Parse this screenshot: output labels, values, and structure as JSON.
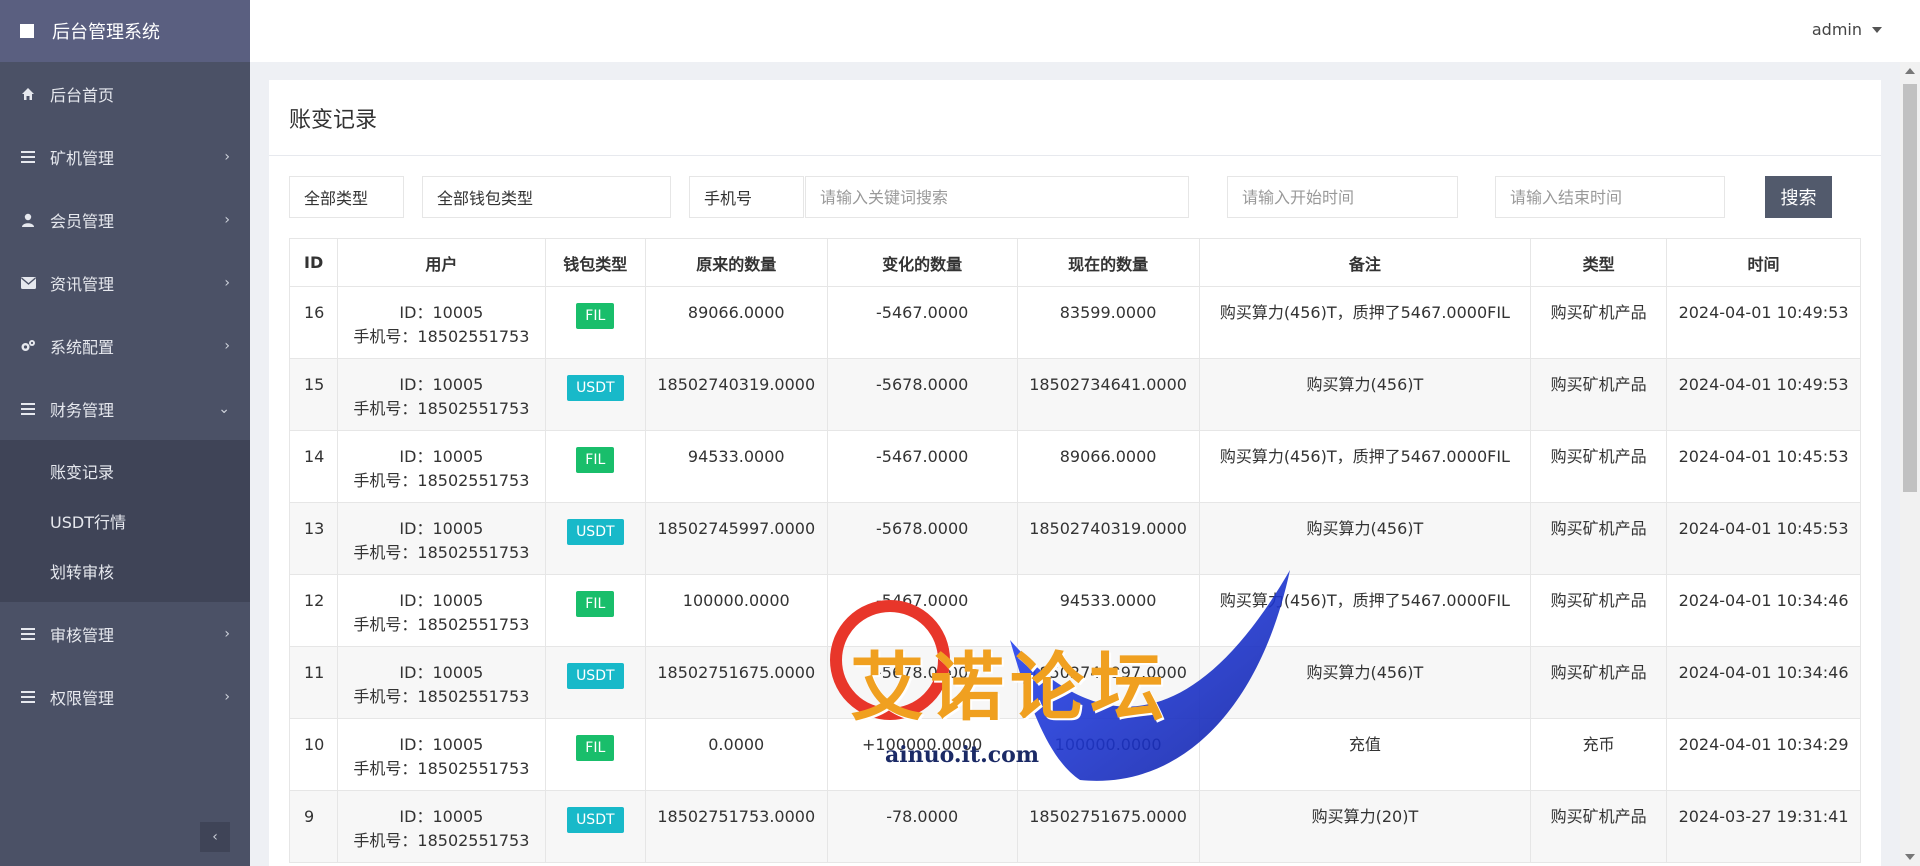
{
  "sidebar": {
    "brand": "后台管理系统",
    "items": [
      {
        "label": "后台首页",
        "icon": "home-icon",
        "chevron": ""
      },
      {
        "label": "矿机管理",
        "icon": "list-icon",
        "chevron": "›"
      },
      {
        "label": "会员管理",
        "icon": "user-icon",
        "chevron": "›"
      },
      {
        "label": "资讯管理",
        "icon": "envelope-icon",
        "chevron": "›"
      },
      {
        "label": "系统配置",
        "icon": "cogs-icon",
        "chevron": "›"
      },
      {
        "label": "财务管理",
        "icon": "list-icon",
        "chevron": "⌄"
      }
    ],
    "subitems": [
      "账变记录",
      "USDT行情",
      "划转审核"
    ],
    "items_after": [
      {
        "label": "审核管理",
        "icon": "list-icon",
        "chevron": "›"
      },
      {
        "label": "权限管理",
        "icon": "list-icon",
        "chevron": "›"
      }
    ],
    "collapse_glyph": "‹"
  },
  "topbar": {
    "user": "admin"
  },
  "panel": {
    "title": "账变记录"
  },
  "filters": {
    "type_select": "全部类型",
    "wallet_select": "全部钱包类型",
    "field_select": "手机号",
    "keyword_placeholder": "请输入关键词搜索",
    "start_placeholder": "请输入开始时间",
    "end_placeholder": "请输入结束时间",
    "search_button": "搜索"
  },
  "table": {
    "headers": [
      "ID",
      "用户",
      "钱包类型",
      "原来的数量",
      "变化的数量",
      "现在的数量",
      "备注",
      "类型",
      "时间"
    ],
    "rows": [
      {
        "id": "16",
        "user_id": "ID：10005",
        "phone": "手机号：18502551753",
        "wallet": "FIL",
        "before": "89066.0000",
        "change": "-5467.0000",
        "after": "83599.0000",
        "remark": "购买算力(456)T，质押了5467.0000FIL",
        "type": "购买矿机产品",
        "time": "2024-04-01 10:49:53"
      },
      {
        "id": "15",
        "user_id": "ID：10005",
        "phone": "手机号：18502551753",
        "wallet": "USDT",
        "before": "18502740319.0000",
        "change": "-5678.0000",
        "after": "18502734641.0000",
        "remark": "购买算力(456)T",
        "type": "购买矿机产品",
        "time": "2024-04-01 10:49:53"
      },
      {
        "id": "14",
        "user_id": "ID：10005",
        "phone": "手机号：18502551753",
        "wallet": "FIL",
        "before": "94533.0000",
        "change": "-5467.0000",
        "after": "89066.0000",
        "remark": "购买算力(456)T，质押了5467.0000FIL",
        "type": "购买矿机产品",
        "time": "2024-04-01 10:45:53"
      },
      {
        "id": "13",
        "user_id": "ID：10005",
        "phone": "手机号：18502551753",
        "wallet": "USDT",
        "before": "18502745997.0000",
        "change": "-5678.0000",
        "after": "18502740319.0000",
        "remark": "购买算力(456)T",
        "type": "购买矿机产品",
        "time": "2024-04-01 10:45:53"
      },
      {
        "id": "12",
        "user_id": "ID：10005",
        "phone": "手机号：18502551753",
        "wallet": "FIL",
        "before": "100000.0000",
        "change": "-5467.0000",
        "after": "94533.0000",
        "remark": "购买算力(456)T，质押了5467.0000FIL",
        "type": "购买矿机产品",
        "time": "2024-04-01 10:34:46"
      },
      {
        "id": "11",
        "user_id": "ID：10005",
        "phone": "手机号：18502551753",
        "wallet": "USDT",
        "before": "18502751675.0000",
        "change": "-5678.0000",
        "after": "18502745997.0000",
        "remark": "购买算力(456)T",
        "type": "购买矿机产品",
        "time": "2024-04-01 10:34:46"
      },
      {
        "id": "10",
        "user_id": "ID：10005",
        "phone": "手机号：18502551753",
        "wallet": "FIL",
        "before": "0.0000",
        "change": "+100000.0000",
        "after": "100000.0000",
        "remark": "充值",
        "type": "充币",
        "time": "2024-04-01 10:34:29"
      },
      {
        "id": "9",
        "user_id": "ID：10005",
        "phone": "手机号：18502551753",
        "wallet": "USDT",
        "before": "18502751753.0000",
        "change": "-78.0000",
        "after": "18502751675.0000",
        "remark": "购买算力(20)T",
        "type": "购买矿机产品",
        "time": "2024-03-27 19:31:41"
      }
    ]
  },
  "watermark": {
    "text": "艾诺论坛",
    "sub": "ainuo.it.com"
  },
  "colors": {
    "sidebar": "#4b5166",
    "brand": "#5a5f80",
    "fil": "#19be6b",
    "usdt": "#18b9c9",
    "search_button": "#525a6c"
  }
}
